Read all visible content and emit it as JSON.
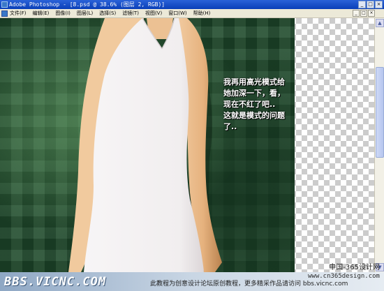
{
  "window": {
    "title": "Adobe Photoshop - [8.psd @ 38.6% (图层 2, RGB)]",
    "controls": [
      "_",
      "□",
      "×"
    ]
  },
  "menubar": {
    "items": [
      "文件(F)",
      "编辑(E)",
      "图像(I)",
      "图层(L)",
      "选择(S)",
      "滤镜(T)",
      "视图(V)",
      "窗口(W)",
      "帮助(H)"
    ],
    "doc_controls": [
      "_",
      "□",
      "×"
    ]
  },
  "annotation": {
    "lines": [
      "我再用高光模式给",
      "她加深一下，看，",
      "现在不红了吧..",
      "这就是模式的问题",
      "了.."
    ]
  },
  "watermark": {
    "site_cn": "中国-365设计网",
    "logo": "BBS.VICNC.COM",
    "notice": "此教程为创意设计论坛原创教程，更多精采作品请访问 bbs.vicnc.com",
    "url": "www.cn365design.com"
  },
  "colors": {
    "titlebar": "#0a3fb8",
    "background_green": "#1f4a2c",
    "dress": "#f4f2f2",
    "skin": "#f0c89c"
  }
}
